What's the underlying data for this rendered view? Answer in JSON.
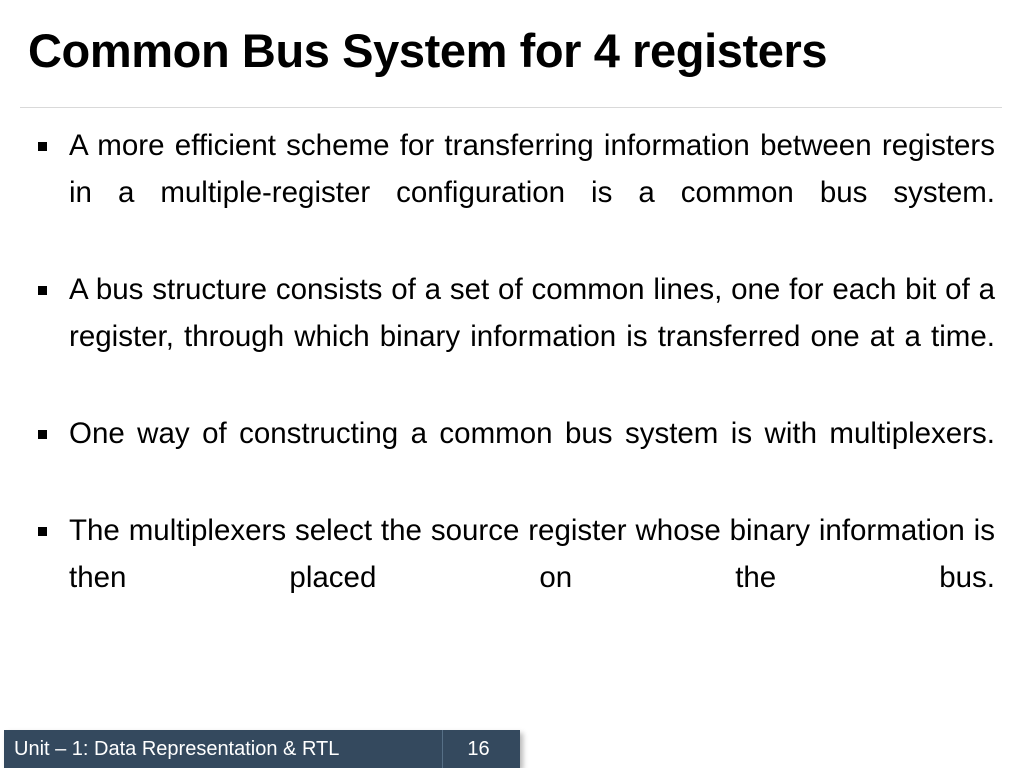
{
  "slide": {
    "title": "Common Bus System for 4 registers",
    "bullets": [
      {
        "marker": "square-bullet",
        "text": "A more efficient scheme for transferring information between registers in a multiple-register configuration is a common bus system."
      },
      {
        "marker": "square-bullet",
        "text": "A bus structure consists of a set of common lines, one for each bit of a register, through which binary information is transferred one at a time."
      },
      {
        "marker": "square-bullet",
        "text": "One way of constructing a common bus system is with multiplexers."
      },
      {
        "marker": "square-bullet",
        "text": "The multiplexers select the source register whose binary information is then placed on the bus."
      }
    ]
  },
  "footer": {
    "label": "Unit – 1: Data Representation & RTL",
    "page_number": "16",
    "background_color": "#34495e",
    "text_color": "#ffffff"
  },
  "theme": {
    "background_color": "#ffffff",
    "title_color": "#000000",
    "body_color": "#000000",
    "rule_color": "#d9d9d9"
  }
}
